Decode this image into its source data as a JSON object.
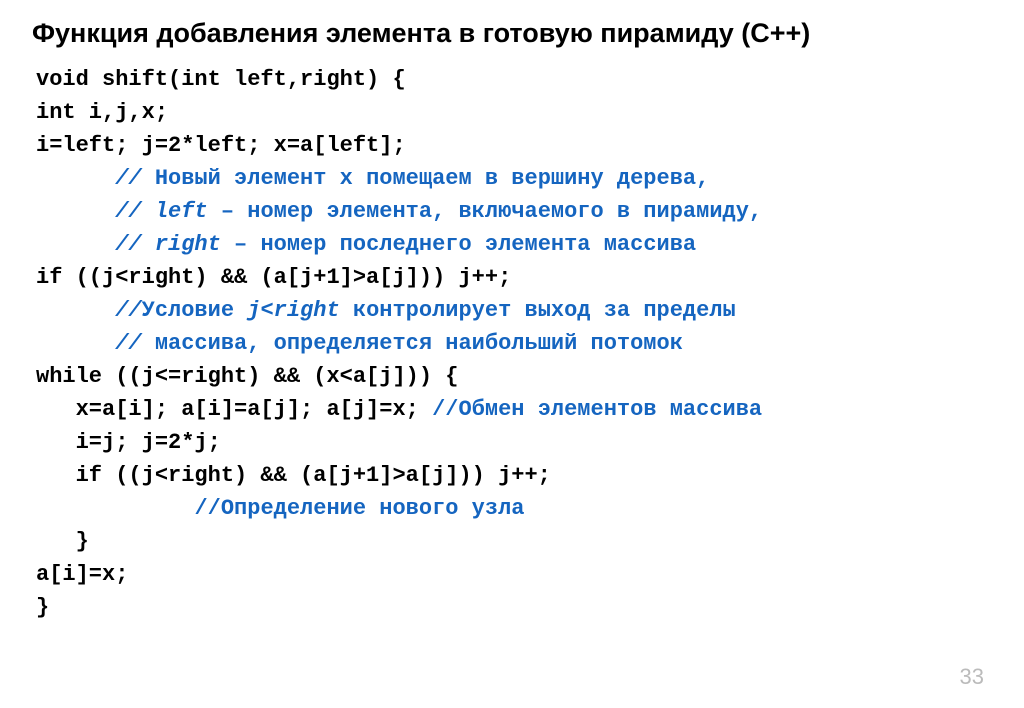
{
  "title": "Функция добавления элемента в готовую пирамиду (С++)",
  "pagenum": "33",
  "code": {
    "l1": "void shift(int left,right) {",
    "l2": "int i,j,x;",
    "l3": "i=left; j=2*left; x=a[left];",
    "l4a": "      // ",
    "l4b": "Новый элемент х помещаем в вершину дерева,",
    "l5a": "      // ",
    "l5b": "left",
    "l5c": " – номер элемента, включаемого в пирамиду,",
    "l6a": "      // ",
    "l6b": "right",
    "l6c": " – номер последнего элемента массива",
    "l7": "if ((j<right) && (a[j+1]>a[j])) j++;",
    "l8a": "      //",
    "l8b": "Условие ",
    "l8c": "j<right",
    "l8d": " контролирует выход за пределы",
    "l9a": "      // ",
    "l9b": "массива, определяется наибольший потомок",
    "l10": "while ((j<=right) && (x<a[j])) {",
    "l11a": "   x=a[i]; a[i]=a[j]; a[j]=x; ",
    "l11b": "//Обмен элементов массива",
    "l12": "   i=j; j=2*j;",
    "l13": "   if ((j<right) && (a[j+1]>a[j])) j++;",
    "l14a": "            ",
    "l14b": "//Определение нового узла",
    "l15": "   }",
    "l16": "a[i]=x;",
    "l17": "}"
  }
}
